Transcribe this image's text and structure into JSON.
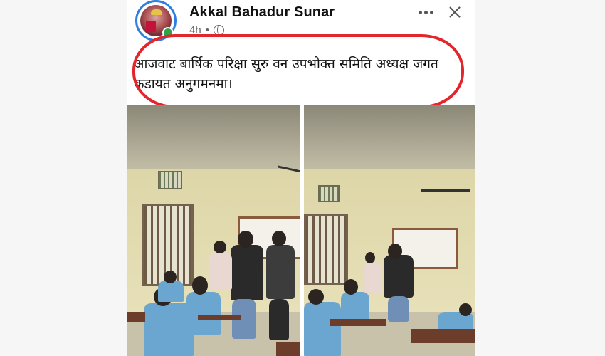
{
  "post": {
    "author": "Akkal Bahadur Sunar",
    "time": "4h",
    "separator": "•",
    "privacy_icon": "globe-icon",
    "text": "आजवाट बार्षिक परिक्षा सुरु वन उपभोक्त समिति अध्यक्ष जगत कडायत अनुगमनमा।"
  },
  "actions": {
    "more_icon": "more-horizontal-icon",
    "close_icon": "close-icon"
  },
  "colors": {
    "annotation_red": "#e2262c",
    "avatar_ring": "#2d7fe0",
    "online_dot": "#30a24b"
  },
  "photos": [
    {
      "name": "classroom-photo-1"
    },
    {
      "name": "classroom-photo-2"
    }
  ]
}
